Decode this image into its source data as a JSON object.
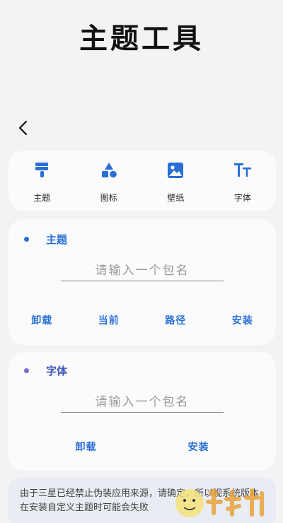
{
  "title": "主题工具",
  "categories": [
    {
      "label": "主题",
      "icon": "brush-icon"
    },
    {
      "label": "图标",
      "icon": "shapes-icon"
    },
    {
      "label": "壁纸",
      "icon": "image-icon"
    },
    {
      "label": "字体",
      "icon": "text-size-icon"
    }
  ],
  "theme_section": {
    "title": "主题",
    "placeholder": "请输入一个包名",
    "actions": [
      "卸载",
      "当前",
      "路径",
      "安装"
    ]
  },
  "font_section": {
    "title": "字体",
    "placeholder": "请输入一个包名",
    "actions": [
      "卸载",
      "安装"
    ]
  },
  "notice": "由于三星已经禁止伪装应用来源，请确定，所以视系统版本在安装自定义主题时可能会失败",
  "colors": {
    "accent": "#2a6fd6",
    "theme_dot": "#2a6fd6",
    "font_dot": "#7b6bc8",
    "background": "#f3f3f5",
    "card": "#fbfbfc"
  }
}
